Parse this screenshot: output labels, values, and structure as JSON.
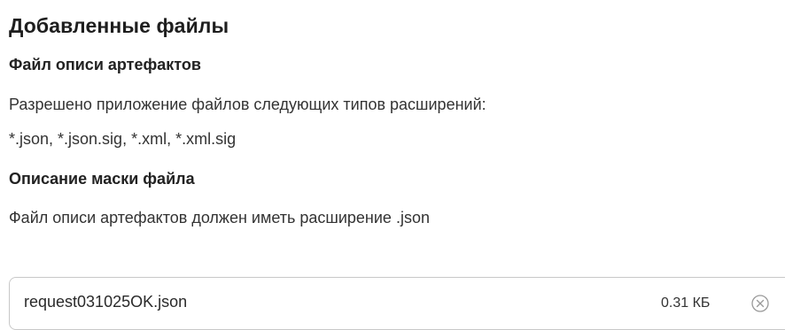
{
  "section": {
    "title": "Добавленные файлы"
  },
  "inventory": {
    "heading": "Файл описи артефактов",
    "allowed_line1": "Разрешено приложение файлов следующих типов расширений:",
    "allowed_line2": "*.json, *.json.sig, *.xml, *.xml.sig"
  },
  "mask": {
    "heading": "Описание маски файла",
    "description": "Файл описи артефактов должен иметь расширение .json"
  },
  "files": [
    {
      "name": "request031025OK.json",
      "size": "0.31 КБ",
      "remove_icon": "close-circle-icon"
    }
  ],
  "colors": {
    "border": "#c8c8c8",
    "icon": "#9a9a9a",
    "text": "#333333"
  }
}
